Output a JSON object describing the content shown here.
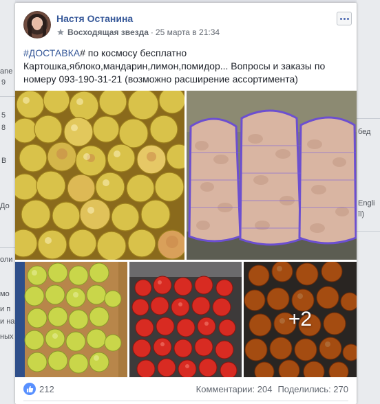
{
  "background": {
    "left_fragments": [
      "ane",
      "9",
      "5",
      "8",
      "B",
      "До",
      "оли",
      "мо",
      "и п",
      "и на",
      "ных"
    ],
    "right_fragments": [
      "бед",
      "Engli",
      "îl)"
    ]
  },
  "post": {
    "author": "Настя Останина",
    "badge": "Восходящая звезда",
    "separator": "·",
    "timestamp": "25 марта в 21:34",
    "text_hashtag": "#ДОСТАВКА",
    "text_body": "# по космосу бесплатно Картошка,яблоко,мандарин,лимон,помидор... Вопросы и заказы по номеру 093-190-31-21 (возможно расширение ассортимента)",
    "photos": [
      {
        "subject": "yellow apples"
      },
      {
        "subject": "potato sacks"
      },
      {
        "subject": "apples in crate"
      },
      {
        "subject": "tomatoes in crate"
      },
      {
        "subject": "tomatoes in crate",
        "more_label": "+2"
      }
    ],
    "likes_count": "212",
    "comments_label": "Комментарии: 204",
    "shares_label": "Поделились: 270"
  },
  "icons": {
    "like": "thumbs-up-icon",
    "badge": "star-icon",
    "menu": "more-options-icon"
  },
  "colors": {
    "link": "#365899",
    "like_blue": "#5890ff",
    "meta": "#616770"
  }
}
